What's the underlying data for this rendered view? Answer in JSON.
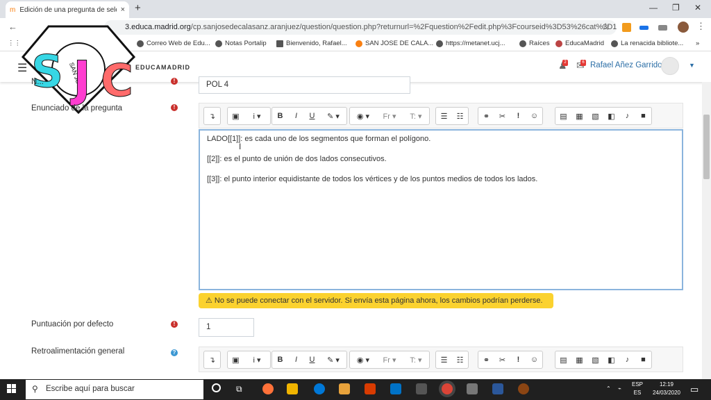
{
  "browser": {
    "tab_title": "Edición de una pregunta de sele",
    "tab_close": "×",
    "new_tab": "+",
    "url_host": "3.educa.madrid.org",
    "url_rest": "/cp.sanjosedecalasanz.aranjuez/question/question.php?returnurl=%2Fquestion%2Fedit.php%3Fcourseid%3D53%26cat%3D1...",
    "bookmarks": [
      "Correo Web de Edu...",
      "Notas Portalip",
      "Bienvenido, Rafael...",
      "SAN JOSE DE CALA...",
      "https://metanet.ucj...",
      "Raíces",
      "EducaMadrid",
      "La renacida bibliote..."
    ]
  },
  "header": {
    "brand": "EDUCAMADRID",
    "notif_count_1": "2",
    "notif_count_2": "6",
    "user_name": "Rafael Añez Garrido"
  },
  "logo": {
    "letters": [
      "S",
      "J",
      "C"
    ],
    "colors": [
      "#37d7e5",
      "#ff3dd0",
      "#ff6b6b"
    ],
    "seal_text": "SAN JOSE"
  },
  "form": {
    "name_label": "N...",
    "name_value": "POL 4",
    "statement_label": "Enunciado de la pregunta",
    "editor_lines": [
      "LADO[[1]]: es cada uno de los segmentos que forman el polígono.",
      "[[2]]: es el punto de unión de dos lados consecutivos.",
      "[[3]]: el punto interior equidistante de todos los vértices y de los puntos medios de todos los lados."
    ],
    "warning": "No se puede conectar con el servidor. Si envía esta página ahora, los cambios podrían perderse.",
    "score_label": "Puntuación por defecto",
    "score_value": "1",
    "feedback_label": "Retroalimentación general"
  },
  "toolbar": {
    "groups": [
      [
        "↴"
      ],
      [
        "▣",
        "i ▾"
      ],
      [
        "B",
        "I",
        "U",
        "✎ ▾"
      ],
      [
        "◉ ▾",
        "Fr ▾",
        "T: ▾"
      ],
      [
        "☰",
        "☷"
      ],
      [
        "⚭",
        "✂",
        "!",
        "☺"
      ],
      [
        "▤",
        "▦",
        "▧",
        "◧",
        "♪",
        "■"
      ]
    ]
  },
  "taskbar": {
    "search_placeholder": "Escribe aquí para buscar",
    "lang_top": "ESP",
    "lang_bottom": "ES",
    "time": "12:19",
    "date": "24/03/2020"
  }
}
